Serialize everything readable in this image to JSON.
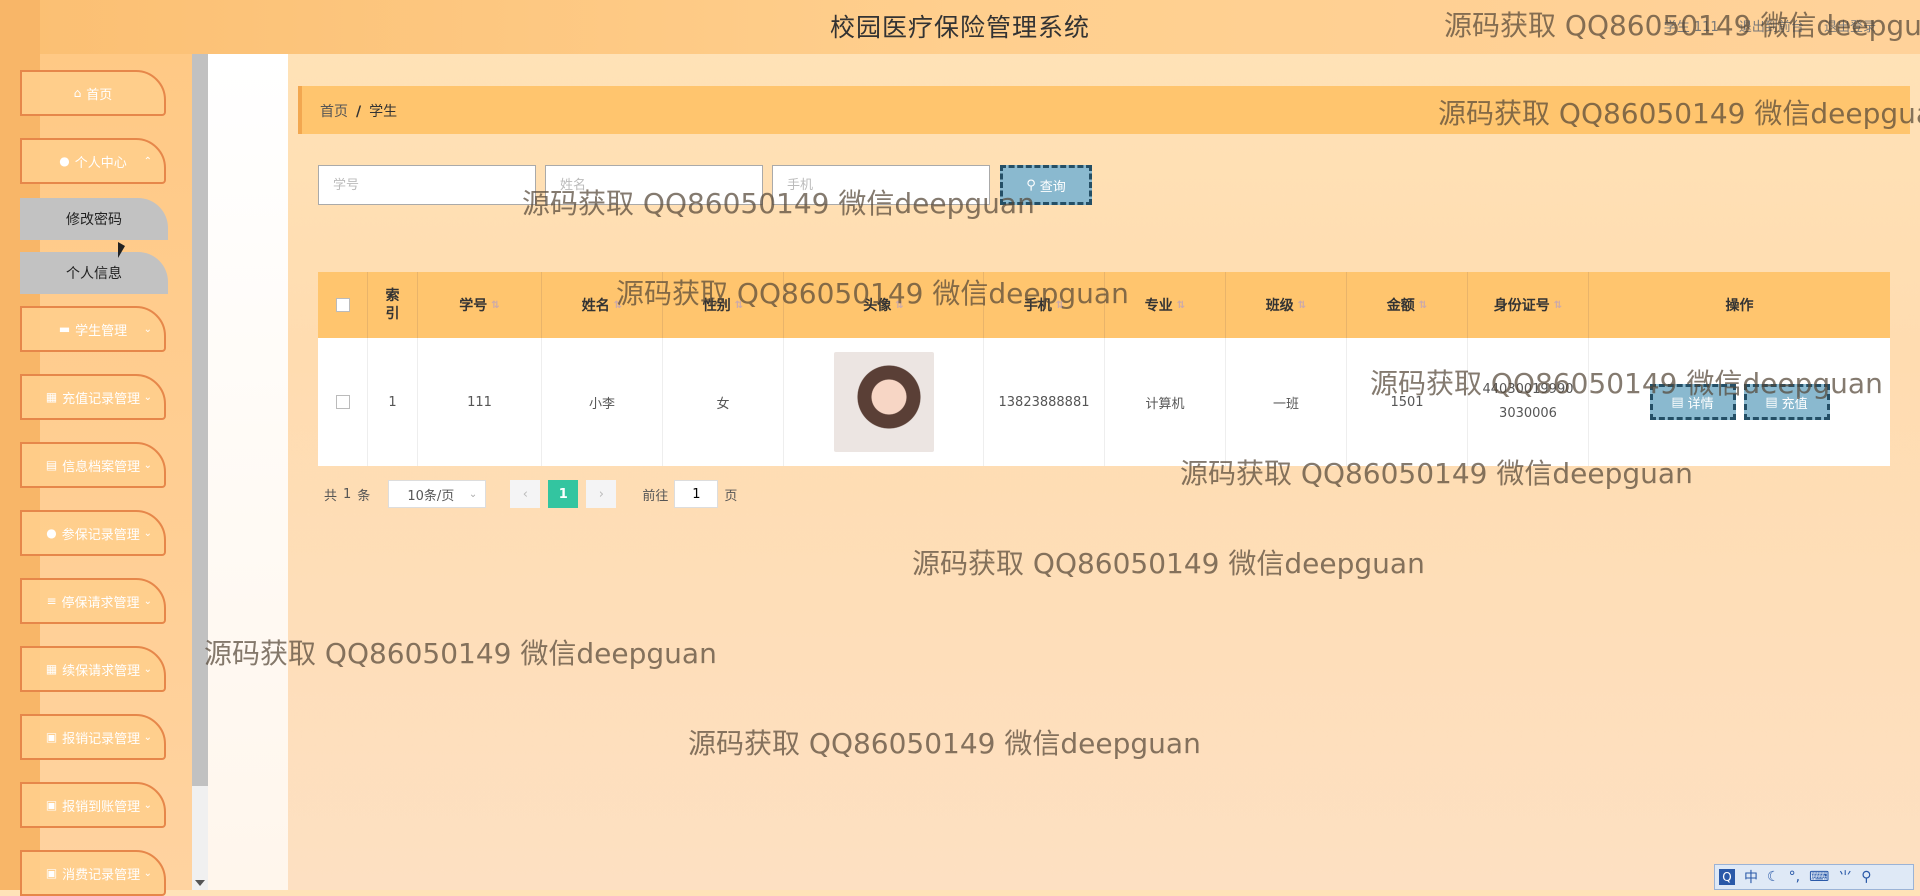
{
  "header": {
    "title": "校园医疗保险管理系统",
    "user": "学生 111",
    "links": [
      "退出到前台",
      "退出登录"
    ]
  },
  "sidebar": {
    "items": [
      {
        "label": "首页",
        "icon": "home-icon",
        "glyph": "⌂"
      },
      {
        "label": "个人中心",
        "icon": "user-icon",
        "glyph": "●",
        "expanded": true,
        "children": [
          "修改密码",
          "个人信息"
        ]
      },
      {
        "label": "学生管理",
        "icon": "card-icon",
        "glyph": "▬"
      },
      {
        "label": "充值记录管理",
        "icon": "grid-icon",
        "glyph": "▦"
      },
      {
        "label": "信息档案管理",
        "icon": "print-icon",
        "glyph": "▤"
      },
      {
        "label": "参保记录管理",
        "icon": "user-icon",
        "glyph": "●"
      },
      {
        "label": "停保请求管理",
        "icon": "list-icon",
        "glyph": "≡"
      },
      {
        "label": "续保请求管理",
        "icon": "grid-icon",
        "glyph": "▦"
      },
      {
        "label": "报销记录管理",
        "icon": "calendar-icon",
        "glyph": "▣"
      },
      {
        "label": "报销到账管理",
        "icon": "calendar-icon",
        "glyph": "▣"
      },
      {
        "label": "消费记录管理",
        "icon": "calendar-icon",
        "glyph": "▣"
      }
    ]
  },
  "breadcrumb": {
    "home": "首页",
    "current": "学生"
  },
  "search": {
    "placeholders": [
      "学号",
      "姓名",
      "手机"
    ],
    "button_label": "查询"
  },
  "table": {
    "columns": [
      "索引",
      "学号",
      "姓名",
      "性别",
      "头像",
      "手机",
      "专业",
      "班级",
      "金额",
      "身份证号",
      "操作"
    ],
    "rows": [
      {
        "index": "1",
        "student_no": "111",
        "name": "小李",
        "gender": "女",
        "phone": "13823888881",
        "major": "计算机",
        "class": "一班",
        "amount": "1501",
        "id_card": "440300199903030006"
      }
    ],
    "actions": [
      "详情",
      "充值"
    ]
  },
  "pagination": {
    "total_prefix": "共",
    "total": "1",
    "total_suffix": "条",
    "page_size": "10条/页",
    "current_page": "1",
    "goto_prefix": "前往",
    "goto_value": "1",
    "goto_suffix": "页"
  },
  "watermark": "源码获取 QQ86050149 微信deepguan",
  "ime": {
    "labels": [
      "中",
      "☾",
      "°,",
      "⌨",
      "⺌",
      "⚲"
    ]
  },
  "colors": {
    "accent_orange": "#ffc56e",
    "button_blue": "#8ab9cf",
    "page_active": "#33c5a0",
    "menu_border": "#e6874a"
  }
}
